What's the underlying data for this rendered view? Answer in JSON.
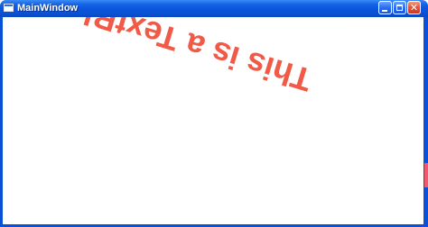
{
  "window": {
    "title": "MainWindow",
    "icon": "window-icon",
    "controls": {
      "minimize": "minimize-icon",
      "maximize": "maximize-icon",
      "close": "close-icon",
      "close_glyph": "✕"
    }
  },
  "content": {
    "textblock": "This is a TextBlock",
    "text_color": "#f05a47",
    "rotation": "rotated, upside-down"
  },
  "colors": {
    "titlebar": "#0a55dc",
    "close_button": "#e0523a",
    "client_background": "#ffffff"
  }
}
